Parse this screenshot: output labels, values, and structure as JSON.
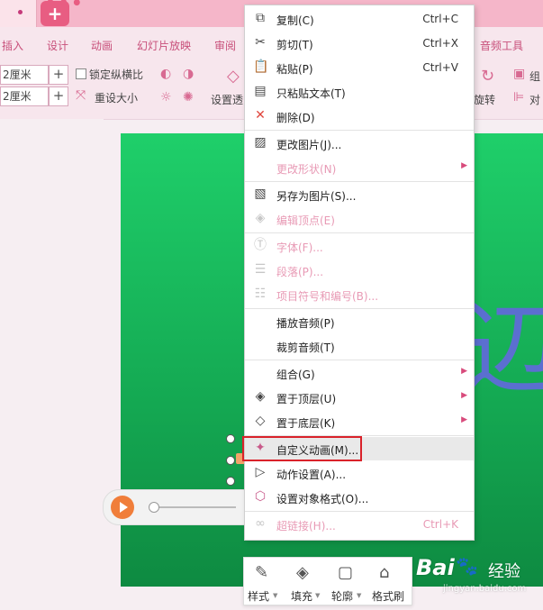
{
  "titlebar": {
    "new_tab": "+"
  },
  "ribbon": {
    "tabs": [
      "插入",
      "设计",
      "动画",
      "幻灯片放映",
      "审阅",
      "音频工具"
    ]
  },
  "toolbar": {
    "width_value": "2厘米",
    "height_value": "2厘米",
    "plus": "+",
    "lock_ratio": "锁定纵横比",
    "resize": "重设大小",
    "transparency": "设置透",
    "rotate": "旋转",
    "group_short": "组",
    "align_short": "对"
  },
  "slide": {
    "big_glyph": "辺"
  },
  "context_menu": {
    "items": [
      {
        "icon": "copy-icon",
        "label": "复制(C)",
        "shortcut": "Ctrl+C",
        "disabled": false
      },
      {
        "icon": "cut-icon",
        "label": "剪切(T)",
        "shortcut": "Ctrl+X",
        "disabled": false
      },
      {
        "icon": "paste-icon",
        "label": "粘贴(P)",
        "shortcut": "Ctrl+V",
        "disabled": false
      },
      {
        "icon": "paste-text-icon",
        "label": "只粘贴文本(T)",
        "shortcut": "",
        "disabled": false
      },
      {
        "icon": "delete-icon",
        "label": "删除(D)",
        "shortcut": "",
        "disabled": false
      },
      {
        "icon": "change-picture-icon",
        "label": "更改图片(J)...",
        "shortcut": "",
        "disabled": false
      },
      {
        "icon": "",
        "label": "更改形状(N)",
        "shortcut": "",
        "disabled": true
      },
      {
        "icon": "save-picture-icon",
        "label": "另存为图片(S)...",
        "shortcut": "",
        "disabled": false
      },
      {
        "icon": "edit-points-icon",
        "label": "编辑顶点(E)",
        "shortcut": "",
        "disabled": true
      },
      {
        "icon": "font-icon",
        "label": "字体(F)...",
        "shortcut": "",
        "disabled": true
      },
      {
        "icon": "paragraph-icon",
        "label": "段落(P)...",
        "shortcut": "",
        "disabled": true
      },
      {
        "icon": "bullets-icon",
        "label": "项目符号和编号(B)...",
        "shortcut": "",
        "disabled": true
      },
      {
        "icon": "",
        "label": "播放音频(P)",
        "shortcut": "",
        "disabled": false
      },
      {
        "icon": "",
        "label": "裁剪音频(T)",
        "shortcut": "",
        "disabled": false
      },
      {
        "icon": "",
        "label": "组合(G)",
        "shortcut": "",
        "disabled": false
      },
      {
        "icon": "bring-front-icon",
        "label": "置于顶层(U)",
        "shortcut": "",
        "disabled": false
      },
      {
        "icon": "send-back-icon",
        "label": "置于底层(K)",
        "shortcut": "",
        "disabled": false
      },
      {
        "icon": "custom-animation-icon",
        "label": "自定义动画(M)...",
        "shortcut": "",
        "disabled": false
      },
      {
        "icon": "action-settings-icon",
        "label": "动作设置(A)...",
        "shortcut": "",
        "disabled": false
      },
      {
        "icon": "format-object-icon",
        "label": "设置对象格式(O)...",
        "shortcut": "",
        "disabled": false
      },
      {
        "icon": "hyperlink-icon",
        "label": "超链接(H)...",
        "shortcut": "Ctrl+K",
        "disabled": true
      }
    ]
  },
  "mini_toolbar": {
    "items": [
      {
        "icon": "style-brush-icon",
        "label": "样式"
      },
      {
        "icon": "fill-bucket-icon",
        "label": "填充"
      },
      {
        "icon": "outline-icon",
        "label": "轮廓"
      },
      {
        "icon": "format-painter-icon",
        "label": "格式刷"
      }
    ]
  },
  "watermark": {
    "brand": "Bai",
    "paw": "🐾",
    "brand2": "经验",
    "url": "jingyan.baidu.com"
  },
  "colors": {
    "highlight_box": "#d9222a",
    "slide_green": "#1fcf6a",
    "accent_pink": "#c84f7a"
  }
}
